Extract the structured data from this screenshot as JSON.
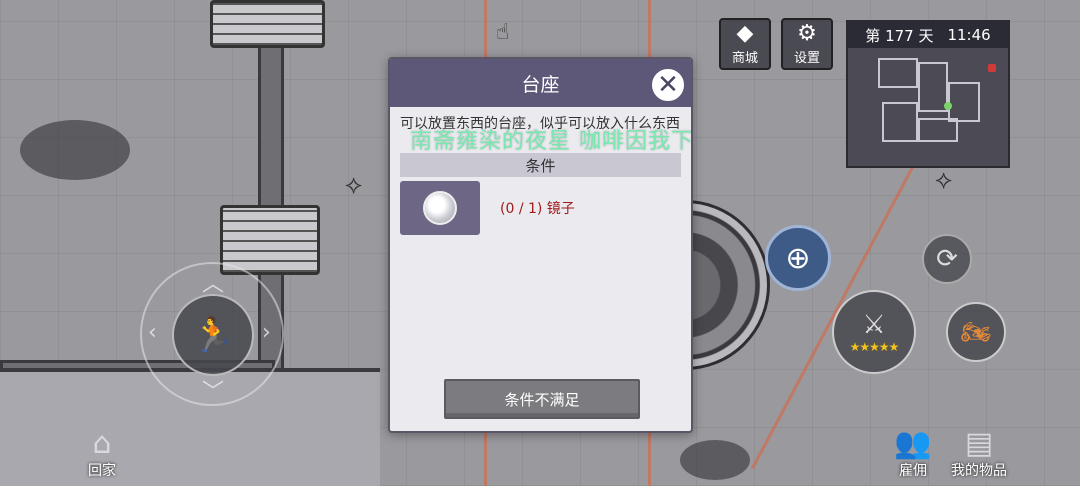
{
  "dialog": {
    "title": "台座",
    "close_icon": "close-icon",
    "description": "可以放置东西的台座，似乎可以放入什么东西",
    "overlay_text": "南斋雍染的夜星 咖啡因我下",
    "section_title": "条件",
    "condition": {
      "item_icon": "mirror-icon",
      "text": "(0 / 1) 镜子",
      "required": 1,
      "owned": 0
    },
    "action_label": "条件不满足"
  },
  "hud": {
    "shop_label": "商城",
    "settings_label": "设置",
    "minimap": {
      "day_text": "第 177 天",
      "time_text": "11:46"
    },
    "home_label": "回家",
    "hire_label": "雇佣",
    "items_label": "我的物品",
    "weapon_stars": 5
  },
  "colors": {
    "dialog_header": "#5e5878",
    "condition_text": "#a01c1c",
    "overlay_text": "#7be7b0",
    "laser": "#cd6e50"
  }
}
